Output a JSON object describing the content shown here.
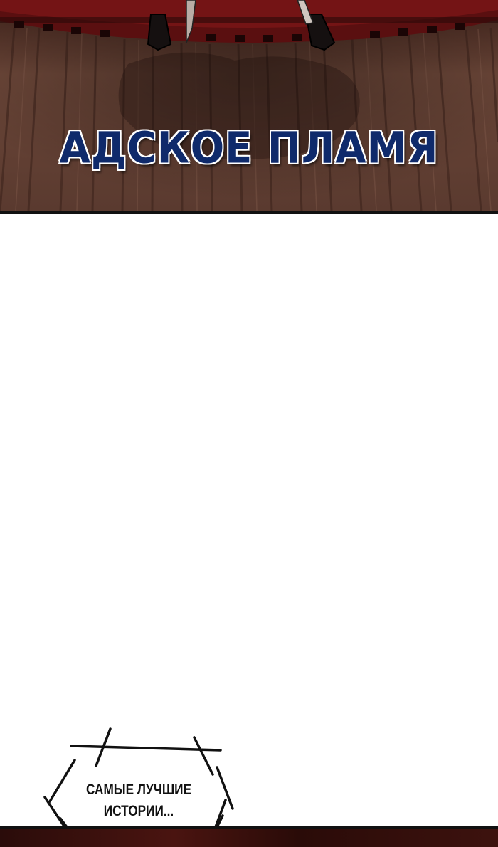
{
  "top_panel": {
    "sfx_text": "АДСКОЕ ПЛАМЯ",
    "scene": "red-drapery-and-wooden-wall-icon",
    "colors": {
      "drapery": "#5a0f10",
      "wall": "#6b4638",
      "wall_dark": "#3b221b",
      "sfx_fill": "#0f2a6b",
      "sfx_outline": "#f0f3ff"
    }
  },
  "caption": {
    "line1": "САМЫЕ ЛУЧШИЕ",
    "line2": "ИСТОРИИ..."
  },
  "bottom_panel": {
    "color": "#3a100c"
  }
}
